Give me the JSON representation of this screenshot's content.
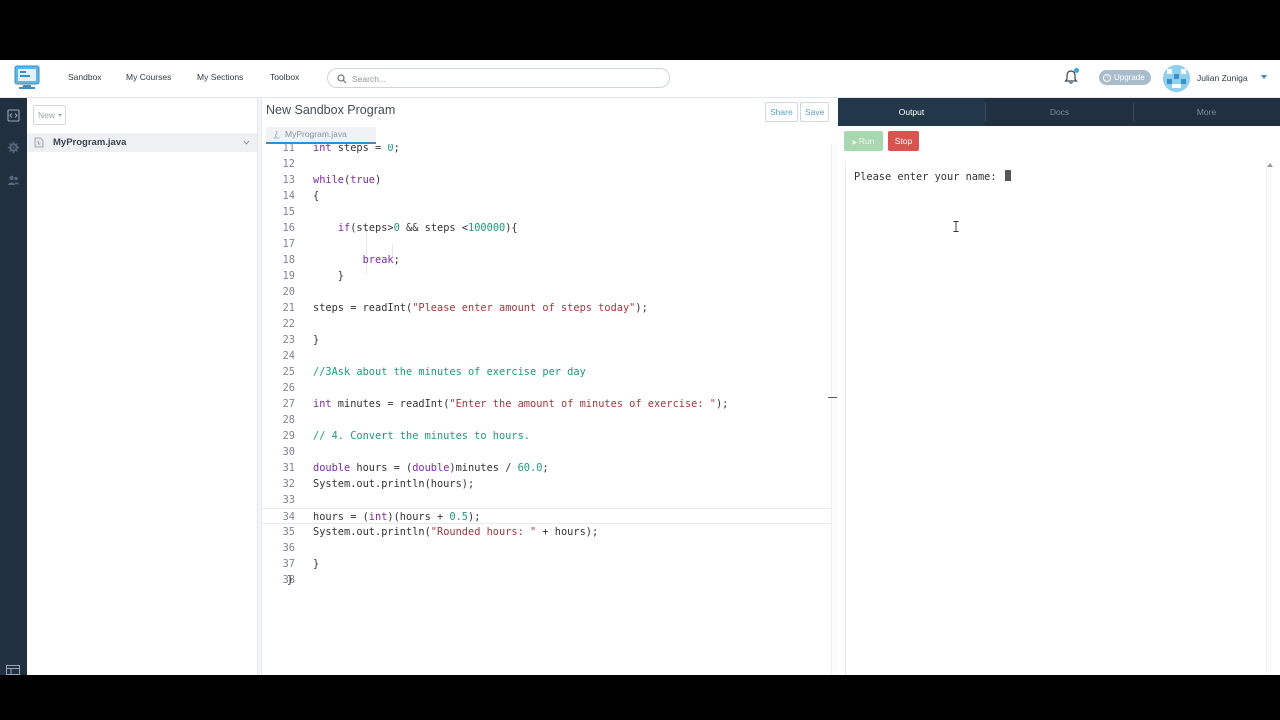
{
  "nav": {
    "links": [
      "Sandbox",
      "My Courses",
      "My Sections",
      "Toolbox"
    ],
    "search_placeholder": "Search...",
    "upgrade": "Upgrade",
    "user": "Julian Zuniga"
  },
  "files": {
    "new_label": "New",
    "items": [
      {
        "name": "MyProgram.java"
      }
    ]
  },
  "editor": {
    "title": "New Sandbox Program",
    "share": "Share",
    "save": "Save",
    "tab": "MyProgram.java",
    "active_line": 34
  },
  "code": [
    {
      "n": "11",
      "t": "int steps = 0;"
    },
    {
      "n": "12",
      "t": ""
    },
    {
      "n": "13",
      "t": "while(true)"
    },
    {
      "n": "14",
      "t": "{"
    },
    {
      "n": "15",
      "t": ""
    },
    {
      "n": "16",
      "t": "    if(steps>0 && steps <100000){"
    },
    {
      "n": "17",
      "t": ""
    },
    {
      "n": "18",
      "t": "        break;"
    },
    {
      "n": "19",
      "t": "    }"
    },
    {
      "n": "20",
      "t": ""
    },
    {
      "n": "21",
      "t": "steps = readInt(\"Please enter amount of steps today\");"
    },
    {
      "n": "22",
      "t": ""
    },
    {
      "n": "23",
      "t": "}"
    },
    {
      "n": "24",
      "t": ""
    },
    {
      "n": "25",
      "t": "//3Ask about the minutes of exercise per day"
    },
    {
      "n": "26",
      "t": ""
    },
    {
      "n": "27",
      "t": "int minutes = readInt(\"Enter the amount of minutes of exercise: \");"
    },
    {
      "n": "28",
      "t": ""
    },
    {
      "n": "29",
      "t": "// 4. Convert the minutes to hours."
    },
    {
      "n": "30",
      "t": ""
    },
    {
      "n": "31",
      "t": "double hours = (double)minutes / 60.0;"
    },
    {
      "n": "32",
      "t": "System.out.println(hours);"
    },
    {
      "n": "33",
      "t": ""
    },
    {
      "n": "34",
      "t": "hours = (int)(hours + 0.5);"
    },
    {
      "n": "35",
      "t": "System.out.println(\"Rounded hours: \" + hours);"
    },
    {
      "n": "36",
      "t": ""
    },
    {
      "n": "37",
      "t": "}"
    },
    {
      "n": "38",
      "t": "}"
    }
  ],
  "output": {
    "tabs": [
      "Output",
      "Docs",
      "More"
    ],
    "run": "Run",
    "stop": "Stop",
    "console": "Please enter your name: "
  },
  "colors": {
    "rail": "#20303f",
    "stop": "#d9534f",
    "run_disabled": "#a8d8b0",
    "accent": "#3d8cc0"
  }
}
